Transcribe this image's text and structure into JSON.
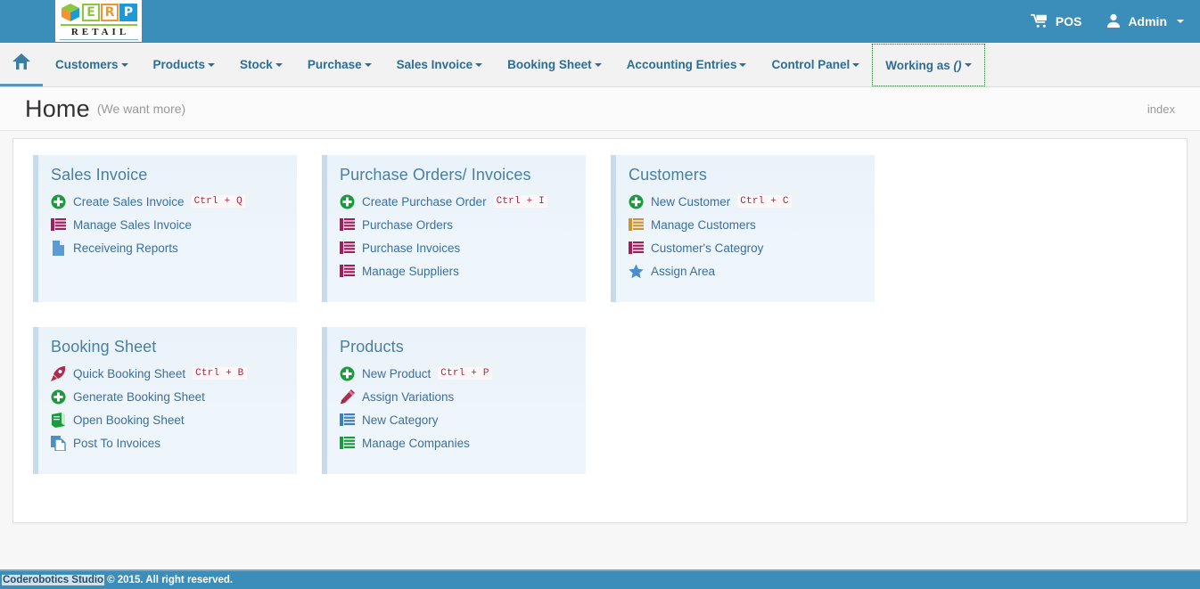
{
  "brand": {
    "letters": [
      "E",
      "R",
      "P"
    ],
    "tagline": "RETAIL",
    "cube_icon": "cube-icon"
  },
  "topbar": {
    "pos_label": "POS",
    "pos_icon": "shopping-cart-icon",
    "admin_label": "Admin",
    "admin_icon": "user-icon",
    "background": "#3b8dba"
  },
  "nav": {
    "home_icon": "home-icon",
    "items": [
      {
        "label": "Customers",
        "caret": true,
        "active": false
      },
      {
        "label": "Products",
        "caret": true,
        "active": false
      },
      {
        "label": "Stock",
        "caret": true,
        "active": false
      },
      {
        "label": "Purchase",
        "caret": true,
        "active": false
      },
      {
        "label": "Sales Invoice",
        "caret": true,
        "active": false
      },
      {
        "label": "Booking Sheet",
        "caret": true,
        "active": false
      },
      {
        "label": "Accounting Entries",
        "caret": true,
        "active": false
      },
      {
        "label": "Control Panel",
        "caret": true,
        "active": false
      },
      {
        "label": "Working as ()",
        "caret": true,
        "active": true
      }
    ]
  },
  "pagehead": {
    "title": "Home",
    "subtitle": "(We want more)",
    "right_label": "index"
  },
  "panels": [
    {
      "title": "Sales Invoice",
      "items": [
        {
          "label": "Create Sales Invoice",
          "shortcut": "Ctrl + Q",
          "icon": "plus-circle-icon",
          "icon_color": "#1a9c3e"
        },
        {
          "label": "Manage Sales Invoice",
          "shortcut": "",
          "icon": "list-icon",
          "icon_color": "#a01f5b"
        },
        {
          "label": "Receiveing Reports",
          "shortcut": "",
          "icon": "document-icon",
          "icon_color": "#5b9bd5"
        }
      ]
    },
    {
      "title": "Purchase Orders/ Invoices",
      "items": [
        {
          "label": "Create Purchase Order",
          "shortcut": "Ctrl + I",
          "icon": "plus-circle-icon",
          "icon_color": "#1a9c3e"
        },
        {
          "label": "Purchase Orders",
          "shortcut": "",
          "icon": "list-icon",
          "icon_color": "#a01f5b"
        },
        {
          "label": "Purchase Invoices",
          "shortcut": "",
          "icon": "list-icon",
          "icon_color": "#a01f5b"
        },
        {
          "label": "Manage Suppliers",
          "shortcut": "",
          "icon": "list-icon",
          "icon_color": "#a01f5b"
        }
      ]
    },
    {
      "title": "Customers",
      "items": [
        {
          "label": "New Customer",
          "shortcut": "Ctrl + C",
          "icon": "plus-circle-icon",
          "icon_color": "#1a9c3e"
        },
        {
          "label": "Manage Customers",
          "shortcut": "",
          "icon": "list-icon",
          "icon_color": "#c9953a"
        },
        {
          "label": "Customer's Categroy",
          "shortcut": "",
          "icon": "list-icon",
          "icon_color": "#a01f5b"
        },
        {
          "label": "Assign Area",
          "shortcut": "",
          "icon": "star-icon",
          "icon_color": "#4a8fc9"
        }
      ]
    },
    {
      "title": "Booking Sheet",
      "items": [
        {
          "label": "Quick Booking Sheet",
          "shortcut": "Ctrl + B",
          "icon": "rocket-icon",
          "icon_color": "#b02a4e"
        },
        {
          "label": "Generate Booking Sheet",
          "shortcut": "",
          "icon": "plus-circle-icon",
          "icon_color": "#1a9c3e"
        },
        {
          "label": "Open Booking Sheet",
          "shortcut": "",
          "icon": "book-icon",
          "icon_color": "#1a9c3e"
        },
        {
          "label": "Post To Invoices",
          "shortcut": "",
          "icon": "copy-icon",
          "icon_color": "#4a8fc9"
        }
      ]
    },
    {
      "title": "Products",
      "items": [
        {
          "label": "New Product",
          "shortcut": "Ctrl + P",
          "icon": "plus-circle-icon",
          "icon_color": "#1a9c3e"
        },
        {
          "label": "Assign Variations",
          "shortcut": "",
          "icon": "pencil-icon",
          "icon_color": "#b02a4e"
        },
        {
          "label": "New Category",
          "shortcut": "",
          "icon": "list-icon",
          "icon_color": "#3a7fbf"
        },
        {
          "label": "Manage Companies",
          "shortcut": "",
          "icon": "list-icon",
          "icon_color": "#1a9c3e"
        }
      ]
    }
  ],
  "footer": {
    "highlight": "Coderobotics Studio",
    "text": "© 2015. All right reserved."
  }
}
